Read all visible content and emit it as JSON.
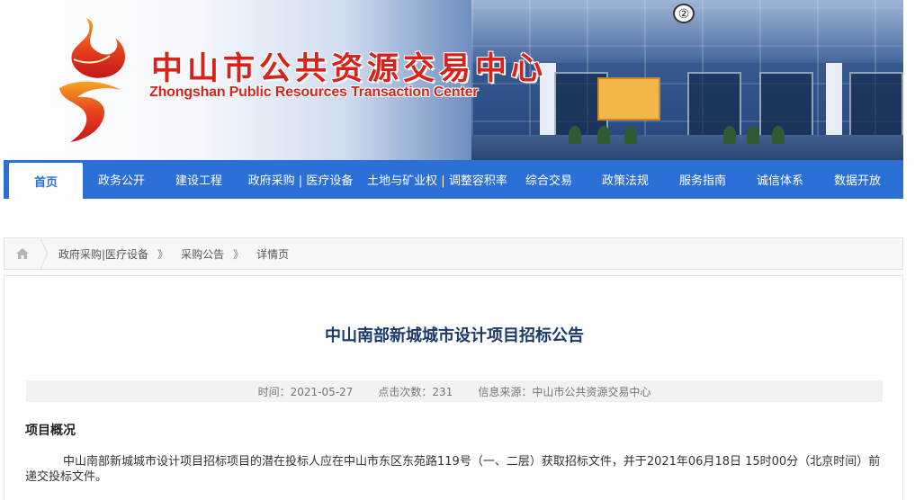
{
  "header": {
    "title_cn": "中山市公共资源交易中心",
    "title_en": "Zhongshan Public Resources Transaction Center",
    "badge": "②",
    "colors": {
      "brand_red": "#d7231a",
      "nav_blue": "#2c6fd6"
    }
  },
  "nav": {
    "items": [
      {
        "label": "首页",
        "active": true
      },
      {
        "label": "政务公开"
      },
      {
        "label": "建设工程"
      },
      {
        "label": "政府采购 | 医疗设备"
      },
      {
        "label": "土地与矿业权 | 调整容积率"
      },
      {
        "label": "综合交易"
      },
      {
        "label": "政策法规"
      },
      {
        "label": "服务指南"
      },
      {
        "label": "诚信体系"
      },
      {
        "label": "数据开放"
      }
    ]
  },
  "breadcrumb": {
    "home_icon": "home-icon",
    "items": [
      "政府采购|医疗设备",
      "采购公告",
      "详情页"
    ],
    "separator": "》"
  },
  "article": {
    "title": "中山南部新城城市设计项目招标公告",
    "meta": {
      "time": "时间：2021-05-27",
      "clicks": "点击次数：231",
      "source": "信息来源：中山市公共资源交易中心"
    },
    "section_title": "项目概况",
    "paragraph": "中山南部新城城市设计项目招标项目的潜在投标人应在中山市东区东苑路119号（一、二层）获取招标文件，并于2021年06月18日 15时00分（北京时间）前递交投标文件。"
  }
}
